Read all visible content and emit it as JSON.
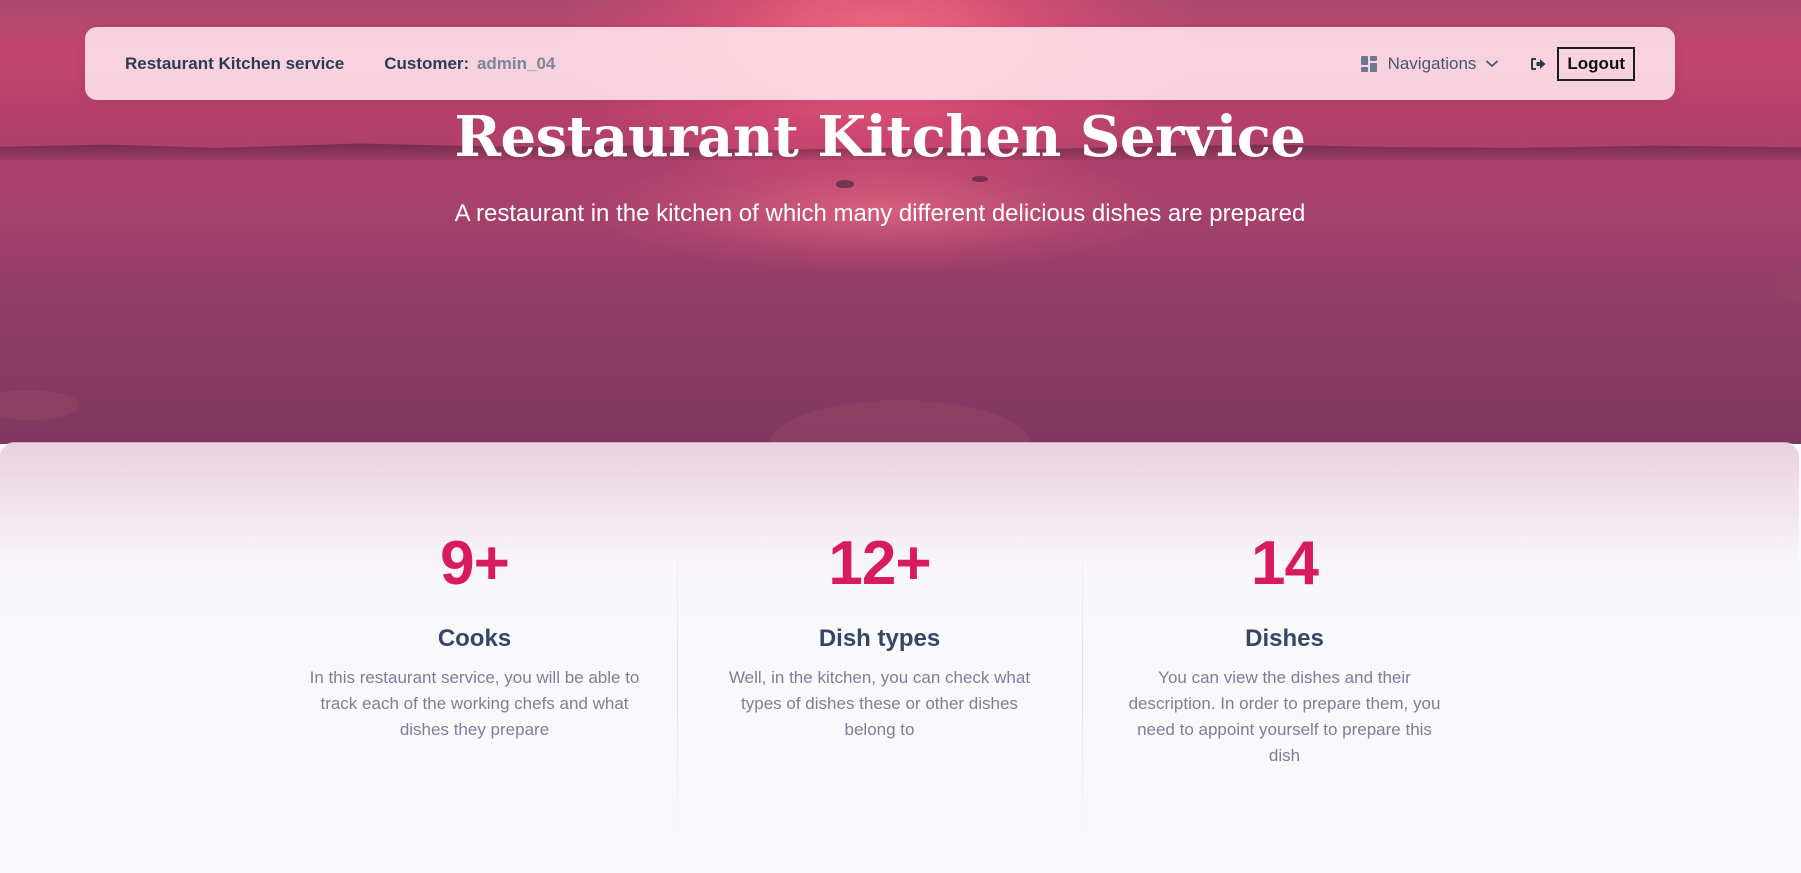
{
  "navbar": {
    "brand": "Restaurant Kitchen service",
    "customer_label": "Customer:",
    "customer_name": "admin_04",
    "navigations_label": "Navigations",
    "navigations_icon": "dashboard-icon",
    "dropdown_icon": "chevron-down-icon",
    "logout_icon": "sign-out-icon",
    "logout_label": "Logout"
  },
  "hero": {
    "title": "Restaurant Kitchen Service",
    "subtitle": "A restaurant in the kitchen of which many different delicious dishes are prepared"
  },
  "stats": [
    {
      "number": "9+",
      "title": "Cooks",
      "description": "In this restaurant service, you will be able to track each of the working chefs and what dishes they prepare"
    },
    {
      "number": "12+",
      "title": "Dish types",
      "description": "Well, in the kitchen, you can check what types of dishes these or other dishes belong to"
    },
    {
      "number": "14",
      "title": "Dishes",
      "description": "You can view the dishes and their description. In order to prepare them, you need to appoint yourself to prepare this dish"
    }
  ],
  "colors": {
    "accent": "#d81b60",
    "heading": "#344767",
    "muted": "#7b809a"
  }
}
